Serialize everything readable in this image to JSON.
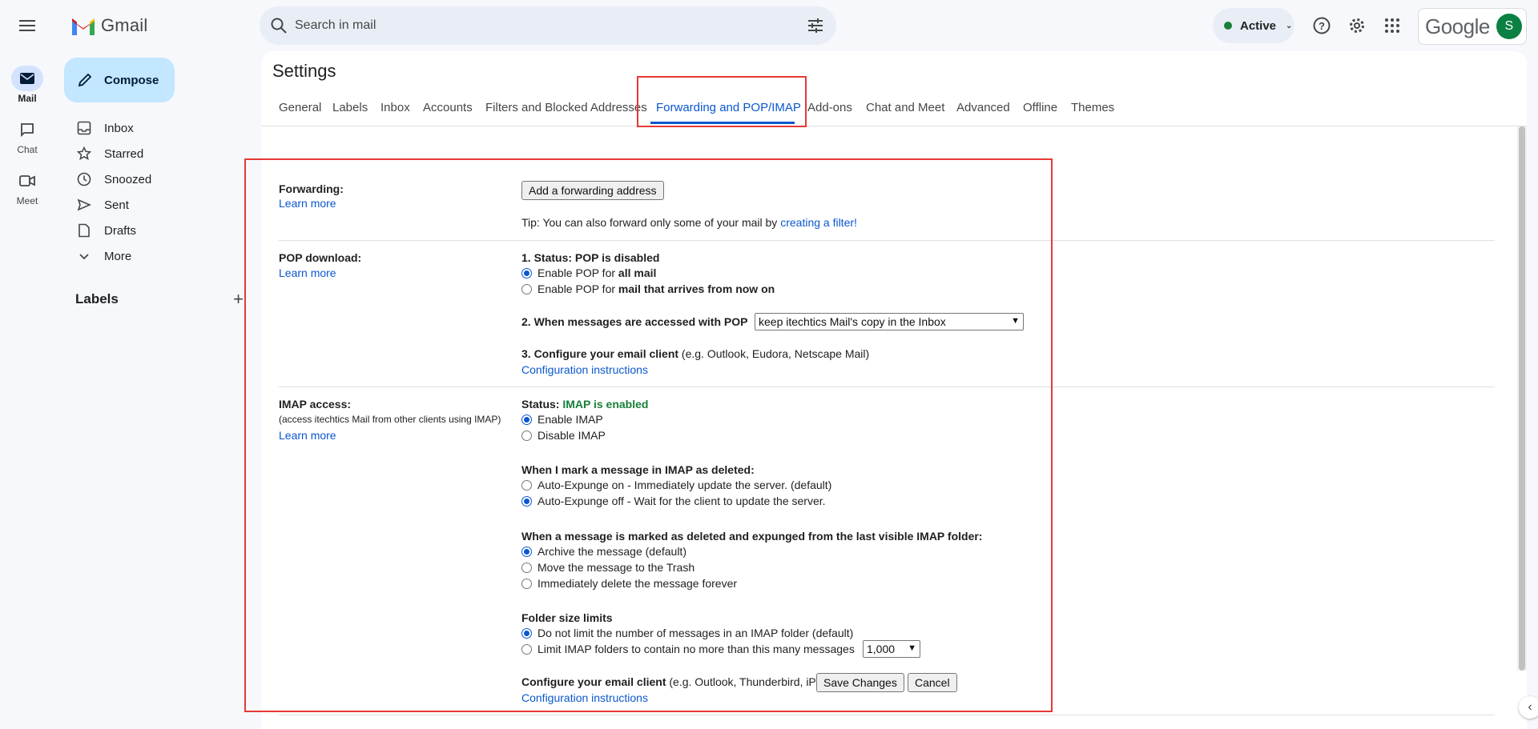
{
  "header": {
    "app_name": "Gmail",
    "search_placeholder": "Search in mail",
    "status_label": "Active",
    "google_word": "Google",
    "avatar_initial": "S"
  },
  "rail": [
    {
      "label": "Mail",
      "icon": "mail-icon"
    },
    {
      "label": "Chat",
      "icon": "chat-icon"
    },
    {
      "label": "Meet",
      "icon": "meet-icon"
    }
  ],
  "compose_label": "Compose",
  "nav": [
    {
      "label": "Inbox",
      "icon": "inbox-icon"
    },
    {
      "label": "Starred",
      "icon": "star-icon"
    },
    {
      "label": "Snoozed",
      "icon": "clock-icon"
    },
    {
      "label": "Sent",
      "icon": "send-icon"
    },
    {
      "label": "Drafts",
      "icon": "draft-icon"
    },
    {
      "label": "More",
      "icon": "chevron-down-icon"
    }
  ],
  "labels_heading": "Labels",
  "settings": {
    "title": "Settings",
    "tabs": [
      "General",
      "Labels",
      "Inbox",
      "Accounts",
      "Filters and Blocked Addresses",
      "Forwarding and POP/IMAP",
      "Add-ons",
      "Chat and Meet",
      "Advanced",
      "Offline",
      "Themes"
    ],
    "active_tab": "Forwarding and POP/IMAP"
  },
  "forwarding": {
    "label": "Forwarding:",
    "learn_more": "Learn more",
    "add_button": "Add a forwarding address",
    "tip_prefix": "Tip: You can also forward only some of your mail by ",
    "tip_link": "creating a filter!"
  },
  "pop": {
    "label": "POP download:",
    "learn_more": "Learn more",
    "status_heading": "1. Status: POP is disabled",
    "opt1_prefix": "Enable POP for ",
    "opt1_bold": "all mail",
    "opt2_prefix": "Enable POP for ",
    "opt2_bold": "mail that arrives from now on",
    "when_heading": "2. When messages are accessed with POP",
    "when_select": "keep itechtics Mail's copy in the Inbox",
    "config_heading": "3. Configure your email client",
    "config_note": " (e.g. Outlook, Eudora, Netscape Mail)",
    "config_link": "Configuration instructions"
  },
  "imap": {
    "label": "IMAP access:",
    "sub_note": "(access itechtics Mail from other clients using IMAP)",
    "learn_more": "Learn more",
    "status_prefix": "Status: ",
    "status_value": "IMAP is enabled",
    "enable": "Enable IMAP",
    "disable": "Disable IMAP",
    "deleted_heading": "When I mark a message in IMAP as deleted:",
    "expunge_on": "Auto-Expunge on - Immediately update the server. (default)",
    "expunge_off": "Auto-Expunge off - Wait for the client to update the server.",
    "expunged_heading": "When a message is marked as deleted and expunged from the last visible IMAP folder:",
    "archive": "Archive the message (default)",
    "trash": "Move the message to the Trash",
    "delete_forever": "Immediately delete the message forever",
    "folder_heading": "Folder size limits",
    "no_limit": "Do not limit the number of messages in an IMAP folder (default)",
    "limit": "Limit IMAP folders to contain no more than this many messages",
    "limit_select": "1,000",
    "config_heading": "Configure your email client",
    "config_note": " (e.g. Outlook, Thunderbird, iPhone)",
    "config_link": "Configuration instructions"
  },
  "actions": {
    "save": "Save Changes",
    "cancel": "Cancel"
  },
  "colors": {
    "accent": "#0b57d0",
    "annotation": "#e53935",
    "status_green": "#188038"
  }
}
